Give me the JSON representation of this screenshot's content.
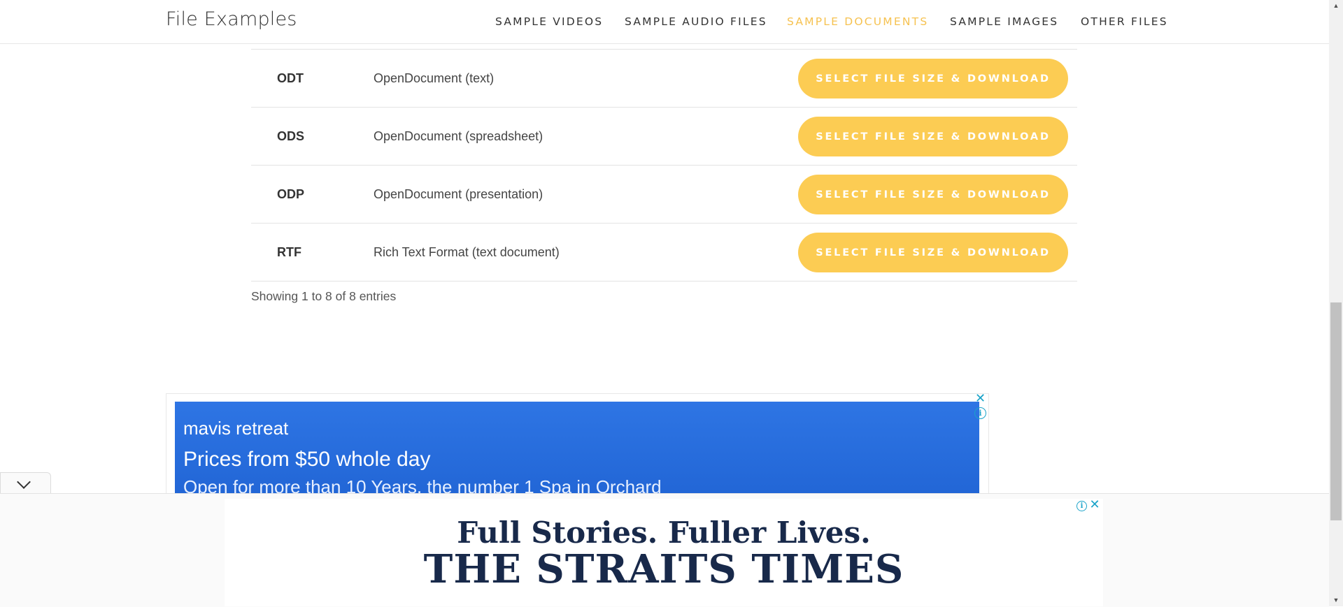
{
  "header": {
    "logo": "File Examples",
    "nav": [
      {
        "label": "SAMPLE VIDEOS",
        "active": false
      },
      {
        "label": "SAMPLE AUDIO FILES",
        "active": false
      },
      {
        "label": "SAMPLE DOCUMENTS",
        "active": true
      },
      {
        "label": "SAMPLE IMAGES",
        "active": false
      },
      {
        "label": "OTHER FILES",
        "active": false
      }
    ]
  },
  "table": {
    "rows": [
      {
        "ext": "ODT",
        "desc": "OpenDocument (text)",
        "button": "SELECT FILE SIZE & DOWNLOAD"
      },
      {
        "ext": "ODS",
        "desc": "OpenDocument (spreadsheet)",
        "button": "SELECT FILE SIZE & DOWNLOAD"
      },
      {
        "ext": "ODP",
        "desc": "OpenDocument (presentation)",
        "button": "SELECT FILE SIZE & DOWNLOAD"
      },
      {
        "ext": "RTF",
        "desc": "Rich Text Format (text document)",
        "button": "SELECT FILE SIZE & DOWNLOAD"
      }
    ],
    "showing": "Showing 1 to 8 of 8 entries"
  },
  "ad1": {
    "brand": "mavis retreat",
    "title": "Prices from $50 whole day",
    "subtitle": "Open for more than 10 Years, the number 1 Spa in Orchard"
  },
  "sticky_ad": {
    "line1": "Full Stories. Fuller Lives.",
    "line2": "THE STRAITS TIMES"
  },
  "icons": {
    "close": "close-icon",
    "info": "info-icon",
    "collapse": "chevron-down-icon"
  },
  "colors": {
    "accent": "#f6c251",
    "button": "#fccc53",
    "ad_blue": "#2c72e2",
    "brand_navy": "#18294a"
  }
}
